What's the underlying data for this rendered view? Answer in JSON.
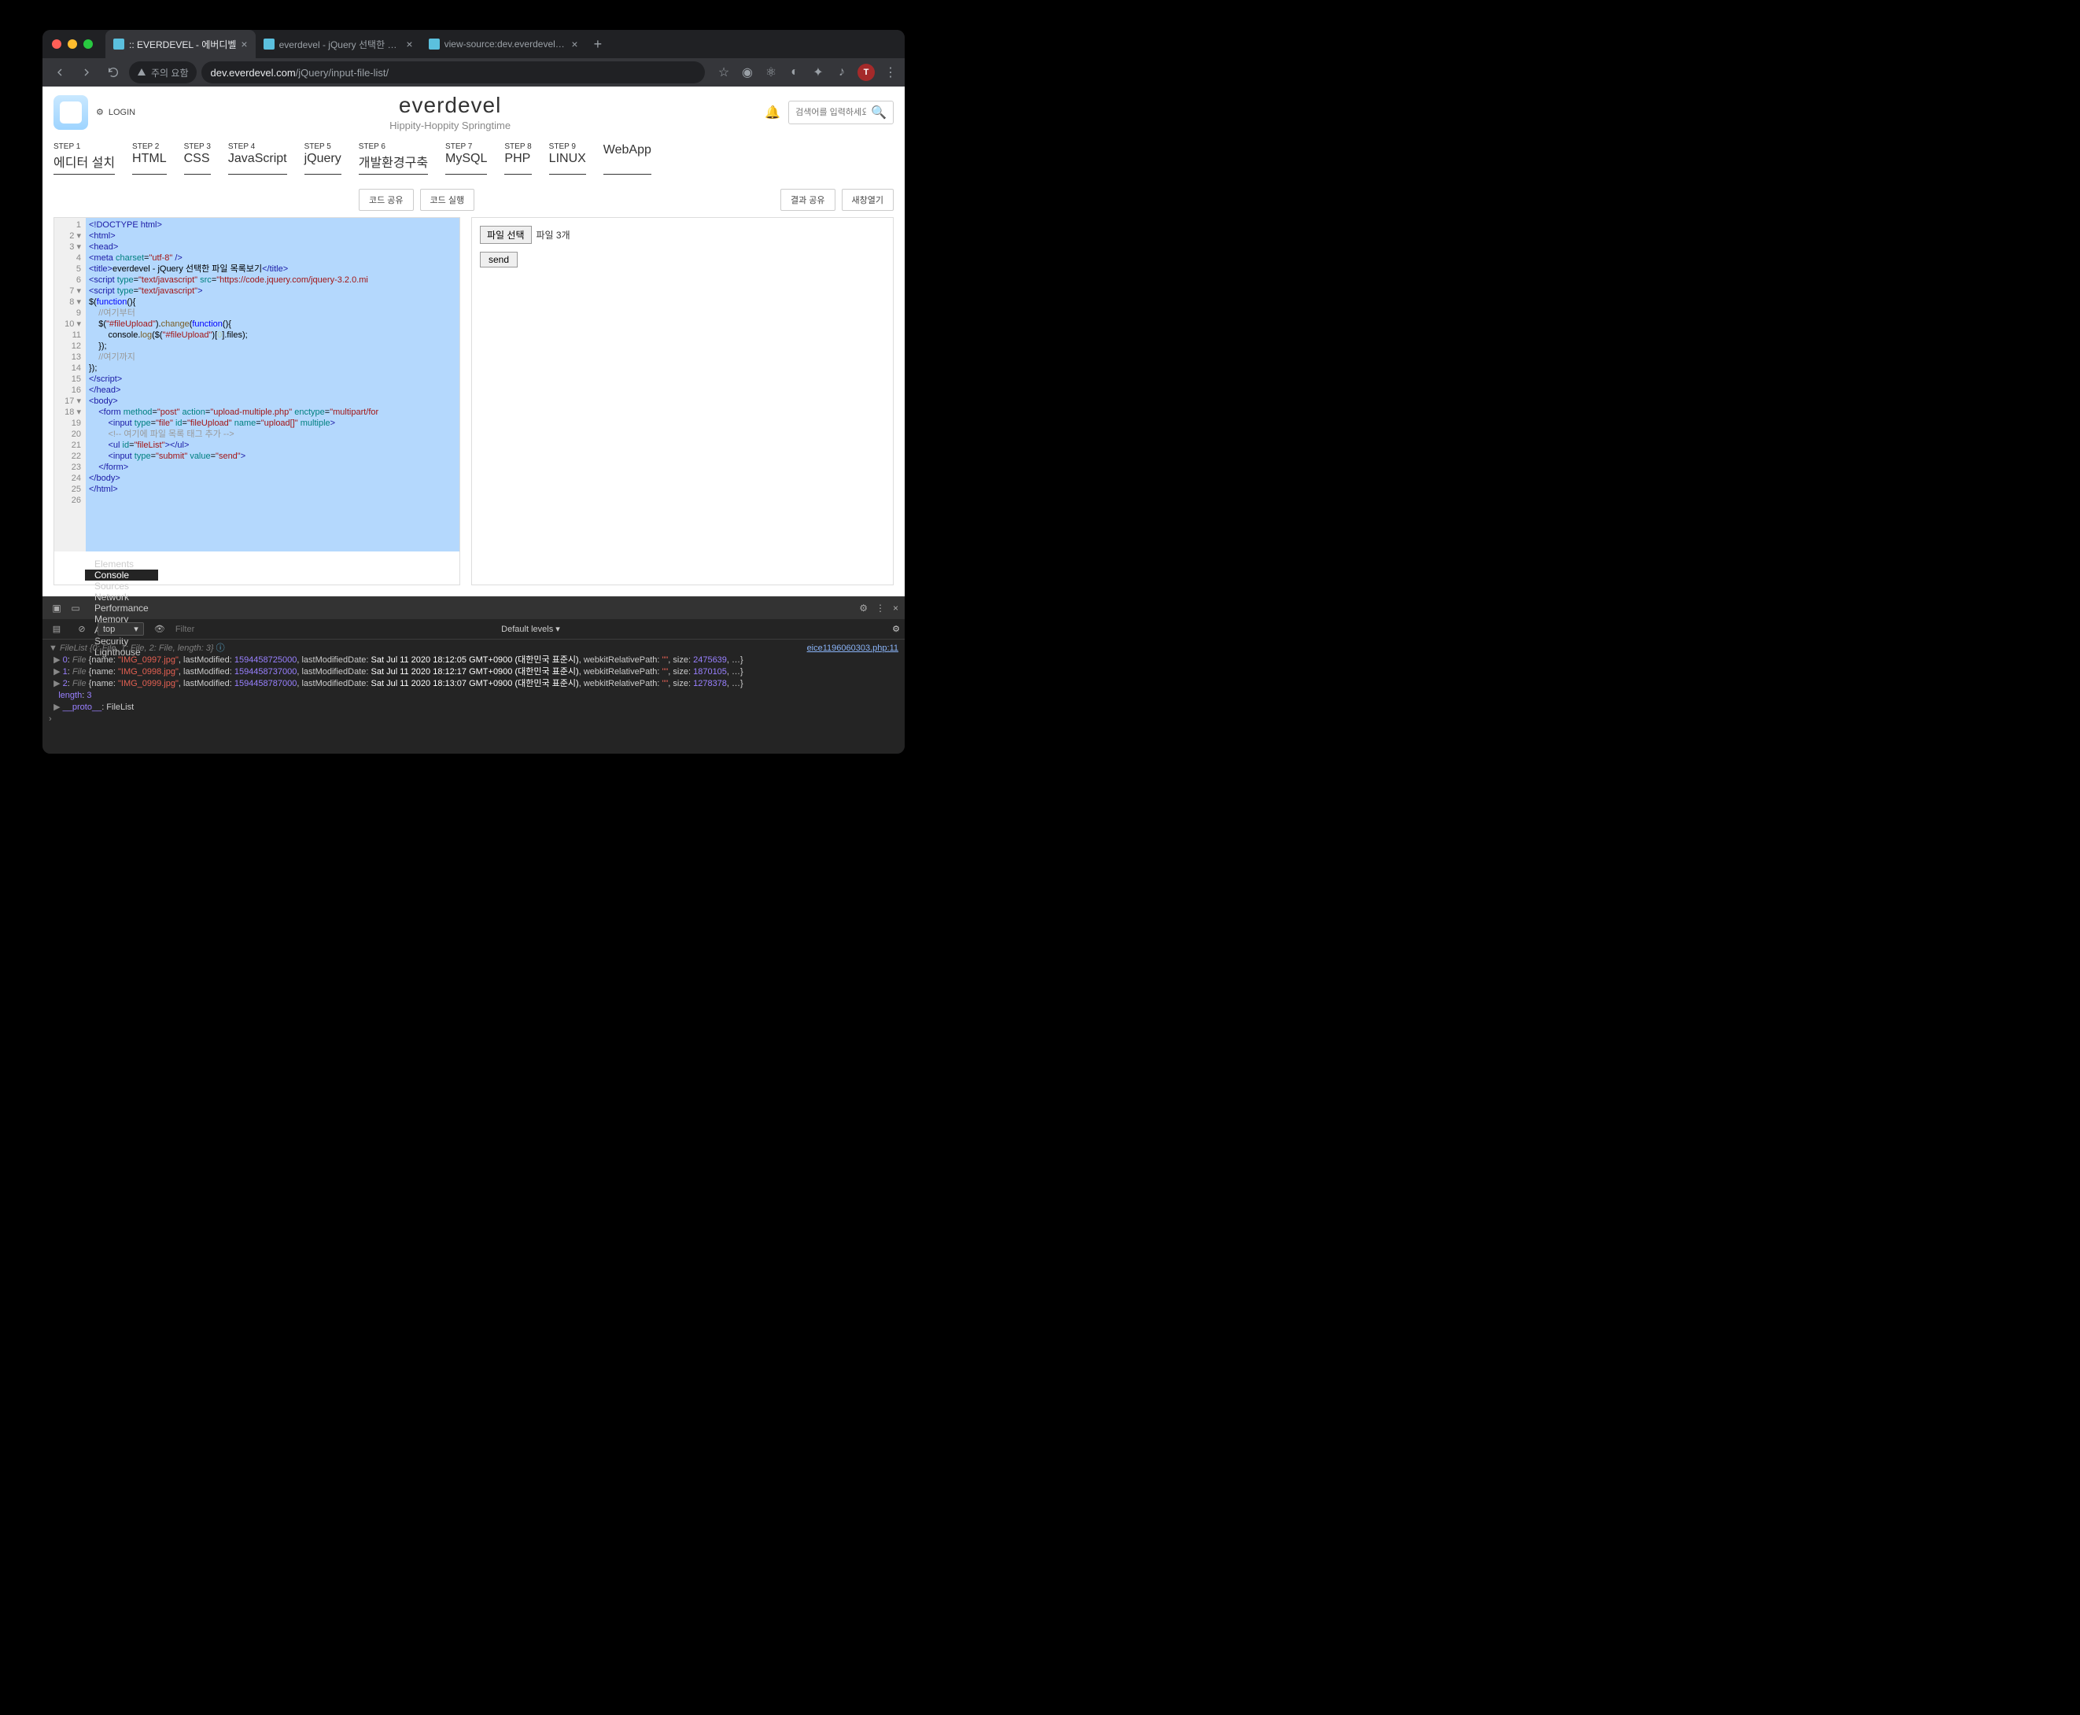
{
  "browser": {
    "tabs": [
      {
        "title": ":: EVERDEVEL - 에버디벨",
        "active": true
      },
      {
        "title": "everdevel - jQuery 선택한 파일 목",
        "active": false
      },
      {
        "title": "view-source:dev.everdevel.com",
        "active": false
      }
    ],
    "security_label": "주의 요함",
    "url_host": "dev.everdevel.com",
    "url_path": "/jQuery/input-file-list/",
    "avatar_letter": "T"
  },
  "header": {
    "login": "LOGIN",
    "brand": "everdevel",
    "brand_sub": "Hippity-Hoppity Springtime",
    "search_placeholder": "검색어를 입력하세요."
  },
  "steps": [
    {
      "num": "STEP 1",
      "label": "에디터 설치"
    },
    {
      "num": "STEP 2",
      "label": "HTML"
    },
    {
      "num": "STEP 3",
      "label": "CSS"
    },
    {
      "num": "STEP 4",
      "label": "JavaScript"
    },
    {
      "num": "STEP 5",
      "label": "jQuery"
    },
    {
      "num": "STEP 6",
      "label": "개발환경구축"
    },
    {
      "num": "STEP 7",
      "label": "MySQL"
    },
    {
      "num": "STEP 8",
      "label": "PHP"
    },
    {
      "num": "STEP 9",
      "label": "LINUX"
    },
    {
      "num": "",
      "label": "WebApp"
    }
  ],
  "toolbar": {
    "share_code": "코드 공유",
    "run_code": "코드 실행",
    "share_result": "결과 공유",
    "new_window": "새창열기"
  },
  "editor": {
    "line_count": 26,
    "lines_html": [
      "<span class='t-tag'>&lt;!DOCTYPE html&gt;</span>",
      "<span class='t-tag'>&lt;html&gt;</span>",
      "<span class='t-tag'>&lt;head&gt;</span>",
      "<span class='t-tag'>&lt;meta</span> <span class='t-attr'>charset</span>=<span class='t-str'>\"utf-8\"</span> <span class='t-tag'>/&gt;</span>",
      "<span class='t-tag'>&lt;title&gt;</span>everdevel - jQuery 선택한 파일 목록보기<span class='t-tag'>&lt;/title&gt;</span>",
      "<span class='t-tag'>&lt;script</span> <span class='t-attr'>type</span>=<span class='t-str'>\"text/javascript\"</span> <span class='t-attr'>src</span>=<span class='t-str'>\"https://code.jquery.com/jquery-3.2.0.mi</span>",
      "<span class='t-tag'>&lt;script</span> <span class='t-attr'>type</span>=<span class='t-str'>\"text/javascript\"</span><span class='t-tag'>&gt;</span>",
      "$(<span class='t-kw'>function</span>(){",
      "    <span class='t-cmt'>//여기부터</span>",
      "    $(<span class='t-str'>\"#fileUpload\"</span>).<span class='t-fn'>change</span>(<span class='t-kw'>function</span>(){",
      "        console.<span class='t-fn'>log</span>($(<span class='t-str'>\"#fileUpload\"</span>)[<span class='t-num'>0</span>].files);",
      "    });",
      "    <span class='t-cmt'>//여기까지</span>",
      "});",
      "<span class='t-tag'>&lt;/script&gt;</span>",
      "<span class='t-tag'>&lt;/head&gt;</span>",
      "<span class='t-tag'>&lt;body&gt;</span>",
      "    <span class='t-tag'>&lt;form</span> <span class='t-attr'>method</span>=<span class='t-str'>\"post\"</span> <span class='t-attr'>action</span>=<span class='t-str'>\"upload-multiple.php\"</span> <span class='t-attr'>enctype</span>=<span class='t-str'>\"multipart/for</span>",
      "        <span class='t-tag'>&lt;input</span> <span class='t-attr'>type</span>=<span class='t-str'>\"file\"</span> <span class='t-attr'>id</span>=<span class='t-str'>\"fileUpload\"</span> <span class='t-attr'>name</span>=<span class='t-str'>\"upload[]\"</span> <span class='t-attr'>multiple</span><span class='t-tag'>&gt;</span>",
      "        <span class='t-cmt'>&lt;!-- 여기에 파일 목록 태그 추가 --&gt;</span>",
      "        <span class='t-tag'>&lt;ul</span> <span class='t-attr'>id</span>=<span class='t-str'>\"fileList\"</span><span class='t-tag'>&gt;&lt;/ul&gt;</span>",
      "        <span class='t-tag'>&lt;input</span> <span class='t-attr'>type</span>=<span class='t-str'>\"submit\"</span> <span class='t-attr'>value</span>=<span class='t-str'>\"send\"</span><span class='t-tag'>&gt;</span>",
      "    <span class='t-tag'>&lt;/form&gt;</span>",
      "<span class='t-tag'>&lt;/body&gt;</span>",
      "<span class='t-tag'>&lt;/html&gt;</span>",
      ""
    ],
    "fold_lines": [
      2,
      3,
      7,
      8,
      10,
      17,
      18
    ]
  },
  "result": {
    "choose_label": "파일 선택",
    "status": "파일 3개",
    "submit_label": "send"
  },
  "devtools": {
    "tabs": [
      "Elements",
      "Console",
      "Sources",
      "Network",
      "Performance",
      "Memory",
      "Application",
      "Security",
      "Lighthouse"
    ],
    "active_tab": "Console",
    "context": "top",
    "filter_placeholder": "Filter",
    "levels": "Default levels ▾",
    "src_link": "eice1196060303.php:11",
    "filelist_summary": "FileList {0: File, 1: File, 2: File, length: 3}",
    "files": [
      {
        "idx": "0",
        "name": "IMG_0997.jpg",
        "lastModified": "1594458725000",
        "date": "Sat Jul 11 2020 18:12:05 GMT+0900 (대한민국 표준시)",
        "size": "2475639"
      },
      {
        "idx": "1",
        "name": "IMG_0998.jpg",
        "lastModified": "1594458737000",
        "date": "Sat Jul 11 2020 18:12:17 GMT+0900 (대한민국 표준시)",
        "size": "1870105"
      },
      {
        "idx": "2",
        "name": "IMG_0999.jpg",
        "lastModified": "1594458787000",
        "date": "Sat Jul 11 2020 18:13:07 GMT+0900 (대한민국 표준시)",
        "size": "1278378"
      }
    ],
    "length_label": "length",
    "length_value": "3",
    "proto_label": "__proto__",
    "proto_value": "FileList"
  }
}
